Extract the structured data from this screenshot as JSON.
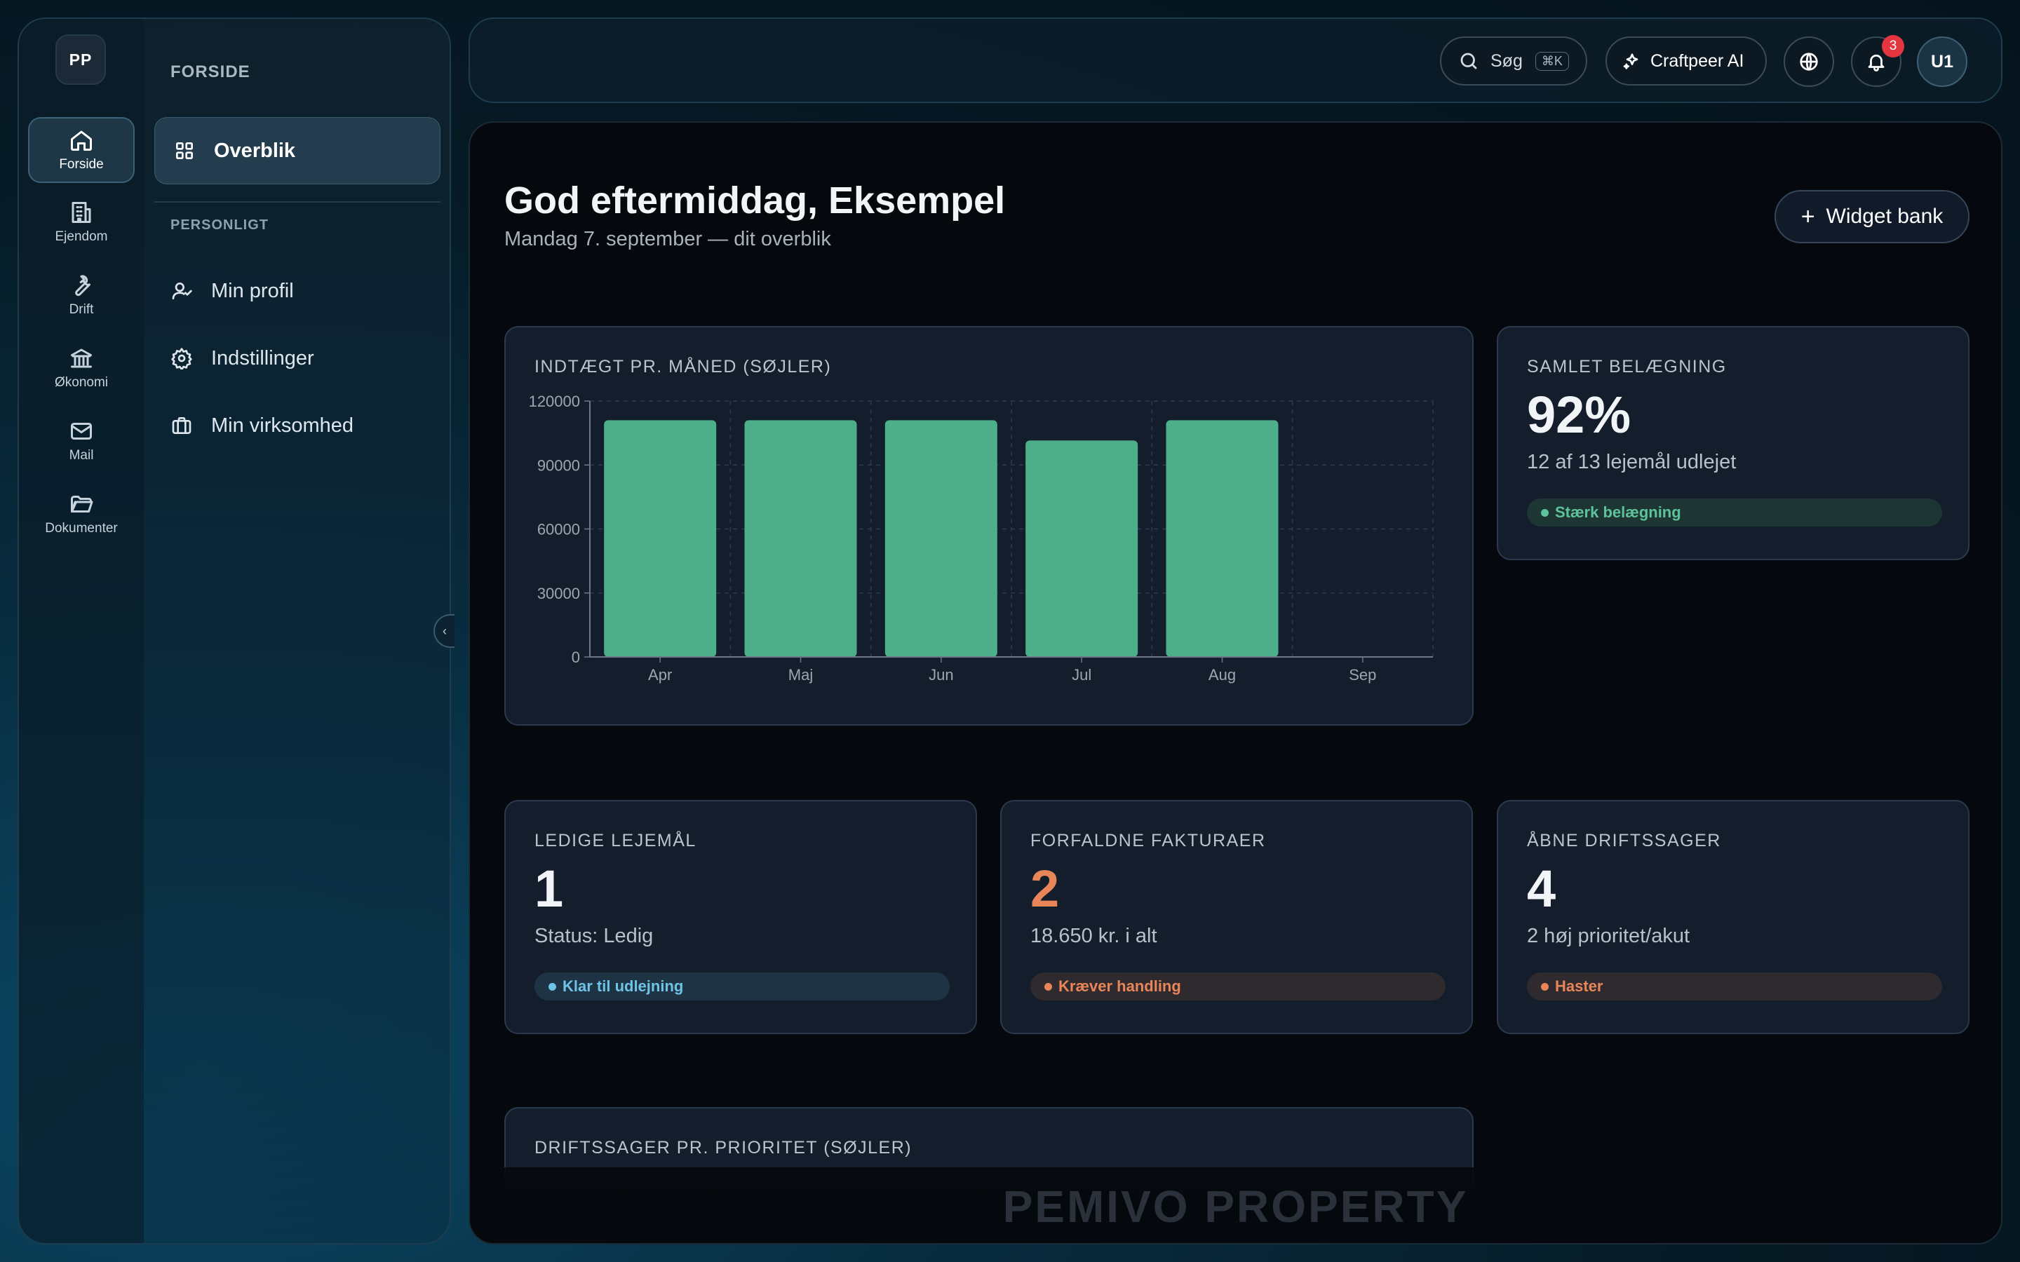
{
  "sidebar": {
    "logo": "PP",
    "rail": [
      {
        "label": "Forside",
        "icon": "home-icon"
      },
      {
        "label": "Ejendom",
        "icon": "building-icon"
      },
      {
        "label": "Drift",
        "icon": "wrench-icon"
      },
      {
        "label": "Økonomi",
        "icon": "bank-icon"
      },
      {
        "label": "Mail",
        "icon": "mail-icon"
      },
      {
        "label": "Dokumenter",
        "icon": "folder-icon"
      }
    ],
    "section_title": "FORSIDE",
    "active_item": "Overblik",
    "personal_heading": "PERSONLIGT",
    "items": [
      {
        "label": "Min profil",
        "icon": "user-icon"
      },
      {
        "label": "Indstillinger",
        "icon": "gear-icon"
      },
      {
        "label": "Min virksomhed",
        "icon": "briefcase-icon"
      }
    ]
  },
  "topbar": {
    "search_label": "Søg",
    "search_shortcut": "⌘K",
    "ai_label": "Craftpeer AI",
    "notification_count": "3",
    "avatar": "U1"
  },
  "header": {
    "greeting": "God eftermiddag, Eksempel",
    "subtitle": "Mandag 7. september — dit overblik",
    "widget_button": "Widget bank"
  },
  "cards": {
    "occupancy": {
      "title": "SAMLET BELÆGNING",
      "value": "92%",
      "sub": "12 af 13 lejemål udlejet",
      "badge": "Stærk belægning"
    },
    "vacant": {
      "title": "LEDIGE LEJEMÅL",
      "value": "1",
      "sub": "Status: Ledig",
      "badge": "Klar til udlejning"
    },
    "overdue": {
      "title": "FORFALDNE FAKTURAER",
      "value": "2",
      "sub": "18.650 kr. i alt",
      "badge": "Kræver handling"
    },
    "ops": {
      "title": "ÅBNE DRIFTSSAGER",
      "value": "4",
      "sub": "2 høj prioritet/akut",
      "badge": "Haster"
    },
    "ops_chart_title": "DRIFTSSAGER PR. PRIORITET (SØJLER)"
  },
  "colors": {
    "bar": "#4caf8a",
    "green": "#5ec29a",
    "blue": "#6ec3e6",
    "orange": "#e8865a"
  },
  "footer_logo": "PEMIVO PROPERTY",
  "chart_data": {
    "type": "bar",
    "title": "INDTÆGT PR. MÅNED (SØJLER)",
    "categories": [
      "Apr",
      "Maj",
      "Jun",
      "Jul",
      "Aug",
      "Sep"
    ],
    "values": [
      111000,
      111000,
      111000,
      101500,
      111000,
      0
    ],
    "ylim": [
      0,
      120000
    ],
    "yticks": [
      0,
      30000,
      60000,
      90000,
      120000
    ],
    "ytick_labels": [
      "0",
      "30000",
      "60000",
      "90000",
      "120000"
    ],
    "grid": true,
    "xlabel": "",
    "ylabel": ""
  }
}
